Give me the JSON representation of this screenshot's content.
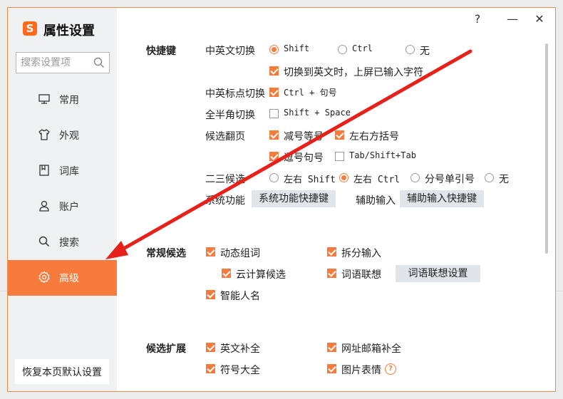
{
  "window": {
    "title": "属性设置",
    "logo_letter": "S",
    "help_label": "?",
    "minimize_label": "—",
    "close_label": "✕"
  },
  "sidebar": {
    "search_placeholder": "搜索设置项",
    "items": [
      {
        "label": "常用",
        "icon": "monitor-icon"
      },
      {
        "label": "外观",
        "icon": "shirt-icon"
      },
      {
        "label": "词库",
        "icon": "book-icon"
      },
      {
        "label": "账户",
        "icon": "user-icon"
      },
      {
        "label": "搜索",
        "icon": "search-icon"
      },
      {
        "label": "高级",
        "icon": "gear-icon",
        "active": true
      }
    ],
    "restore_label": "恢复本页默认设置"
  },
  "shortcuts": {
    "section_title": "快捷键",
    "cn_en_switch": {
      "label": "中英文切换",
      "options": [
        {
          "label": "Shift",
          "checked": true
        },
        {
          "label": "Ctrl",
          "checked": false
        },
        {
          "label": "无",
          "checked": false
        }
      ],
      "commit_on_switch": {
        "label": "切换到英文时，上屏已输入字符",
        "checked": true
      }
    },
    "punct_switch": {
      "label": "中英标点切换",
      "option": "Ctrl + 句号",
      "checked": true
    },
    "width_switch": {
      "label": "全半角切换",
      "option": "Shift + Space",
      "checked": false
    },
    "page_turn": {
      "label": "候选翻页",
      "options": [
        {
          "label": "减号等号",
          "checked": true
        },
        {
          "label": "左右方括号",
          "checked": true
        },
        {
          "label": "逗号句号",
          "checked": true
        },
        {
          "label": "Tab/Shift+Tab",
          "checked": false
        }
      ]
    },
    "second_third": {
      "label": "二三候选",
      "options": [
        {
          "label": "左右 Shift",
          "checked": false
        },
        {
          "label": "左右 Ctrl",
          "checked": true
        },
        {
          "label": "分号单引号",
          "checked": false
        },
        {
          "label": "无",
          "checked": false
        }
      ]
    },
    "system_function": {
      "label": "系统功能",
      "button": "系统功能快捷键"
    },
    "aux_input": {
      "label": "辅助输入",
      "button": "辅助输入快捷键"
    }
  },
  "candidates": {
    "section_title": "常规候选",
    "options": [
      {
        "label": "动态组词",
        "checked": true
      },
      {
        "label": "拆分输入",
        "checked": true
      },
      {
        "label": "云计算候选",
        "checked": true
      },
      {
        "label": "词语联想",
        "checked": true
      },
      {
        "label": "智能人名",
        "checked": true
      }
    ],
    "association_button": "词语联想设置"
  },
  "extensions": {
    "section_title": "候选扩展",
    "options": [
      {
        "label": "英文补全",
        "checked": true
      },
      {
        "label": "网址邮箱补全",
        "checked": true
      },
      {
        "label": "符号大全",
        "checked": true
      },
      {
        "label": "图片表情",
        "checked": true
      }
    ],
    "help_glyph": "?"
  },
  "colors": {
    "accent": "#f77b3c",
    "sidebar_bg": "#eff1f3",
    "button_bg": "#e1e4e8",
    "arrow": "#e8201a"
  }
}
